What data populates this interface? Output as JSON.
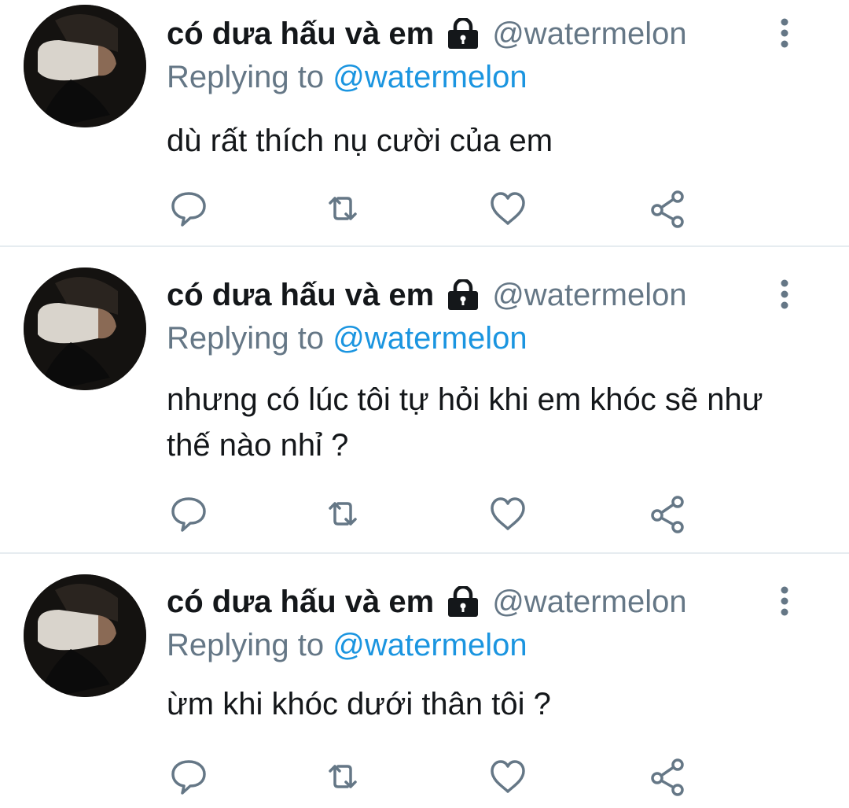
{
  "tweets": [
    {
      "display_name": "có dưa hấu và em",
      "handle": "@watermelon",
      "replying_prefix": "Replying to",
      "replying_to": "@watermelon",
      "text": "dù rất thích nụ cười của em",
      "icons": [
        "avatar",
        "lock-icon",
        "more-vertical-icon",
        "reply-icon",
        "retweet-icon",
        "like-icon",
        "share-icon"
      ]
    },
    {
      "display_name": "có dưa hấu và em",
      "handle": "@watermelon",
      "replying_prefix": "Replying to",
      "replying_to": "@watermelon",
      "text": "nhưng có lúc tôi tự hỏi khi em khóc sẽ như thế nào nhỉ ?",
      "icons": [
        "avatar",
        "lock-icon",
        "more-vertical-icon",
        "reply-icon",
        "retweet-icon",
        "like-icon",
        "share-icon"
      ]
    },
    {
      "display_name": "có dưa hấu và em",
      "handle": "@watermelon",
      "replying_prefix": "Replying to",
      "replying_to": "@watermelon",
      "text": "ừm khi khóc dưới thân tôi ?",
      "icons": [
        "avatar",
        "lock-icon",
        "more-vertical-icon",
        "reply-icon",
        "retweet-icon",
        "like-icon",
        "share-icon"
      ]
    }
  ],
  "colors": {
    "text": "#14171a",
    "secondary": "#657786",
    "mention": "#1b95e0",
    "divider": "#e6ecf0",
    "icon": "#657786"
  }
}
